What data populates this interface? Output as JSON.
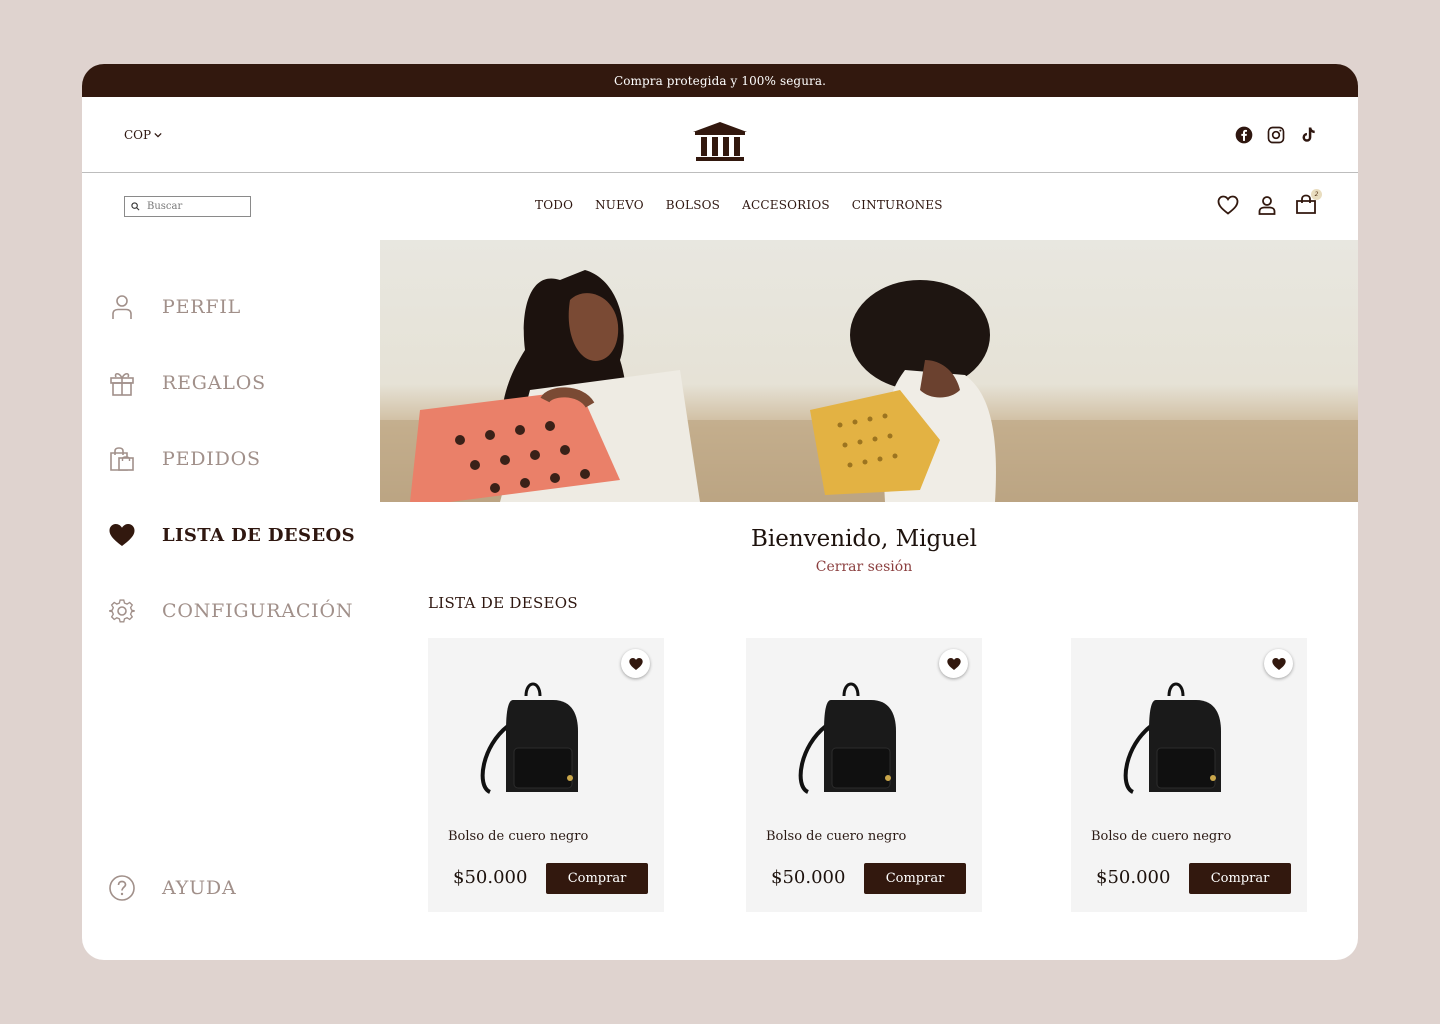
{
  "announcement": "Compra protegida y 100% segura.",
  "header": {
    "currency": "COP",
    "social": [
      "facebook-icon",
      "instagram-icon",
      "tiktok-icon"
    ]
  },
  "search": {
    "placeholder": "Buscar"
  },
  "nav": {
    "items": [
      "TODO",
      "NUEVO",
      "BOLSOS",
      "ACCESORIOS",
      "CINTURONES"
    ],
    "cart_count": "2"
  },
  "sidebar": {
    "items": [
      {
        "label": "PERFIL",
        "icon": "user-icon"
      },
      {
        "label": "REGALOS",
        "icon": "gift-icon"
      },
      {
        "label": "PEDIDOS",
        "icon": "orders-bag-icon"
      },
      {
        "label": "LISTA DE DESEOS",
        "icon": "heart-icon",
        "active": true
      },
      {
        "label": "CONFIGURACIÓN",
        "icon": "gear-icon"
      }
    ],
    "help": {
      "label": "AYUDA",
      "icon": "help-icon"
    }
  },
  "welcome": {
    "title": "Bienvenido, Miguel",
    "logout": "Cerrar sesión"
  },
  "wishlist": {
    "title": "LISTA DE DESEOS",
    "products": [
      {
        "name": "Bolso de cuero negro",
        "price": "$50.000",
        "button": "Comprar"
      },
      {
        "name": "Bolso de cuero negro",
        "price": "$50.000",
        "button": "Comprar"
      },
      {
        "name": "Bolso de cuero negro",
        "price": "$50.000",
        "button": "Comprar"
      }
    ]
  },
  "colors": {
    "brand_dark": "#32180e",
    "page_bg": "#dfd3cf",
    "muted_text": "#a1908a",
    "logout": "#8b3f3f"
  }
}
